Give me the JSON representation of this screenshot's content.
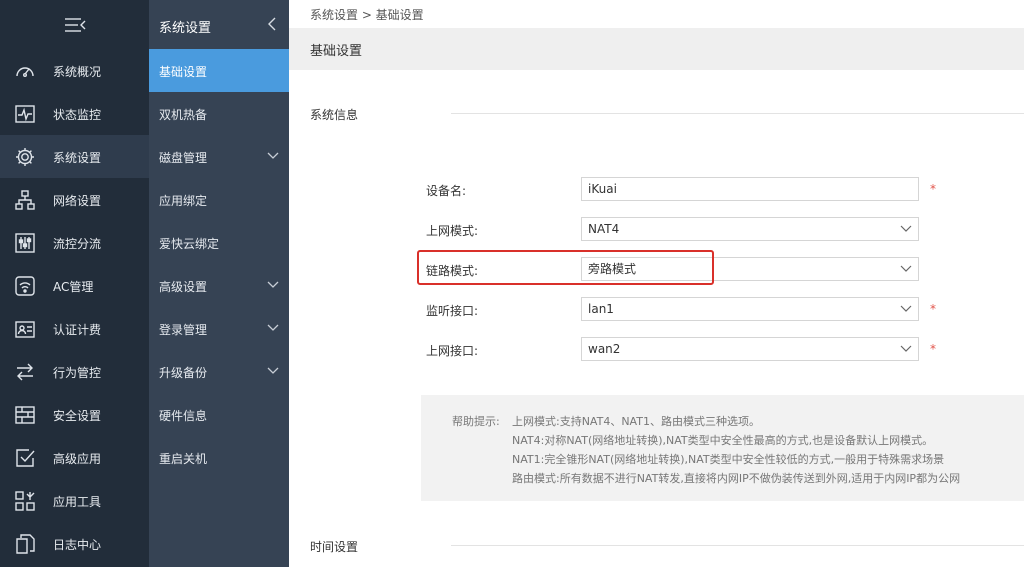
{
  "nav1": {
    "toggle_icon": "menu-collapse-icon",
    "items": [
      {
        "label": "系统概况",
        "icon": "gauge-icon"
      },
      {
        "label": "状态监控",
        "icon": "monitor-pulse-icon"
      },
      {
        "label": "系统设置",
        "icon": "gear-icon"
      },
      {
        "label": "网络设置",
        "icon": "network-icon"
      },
      {
        "label": "流控分流",
        "icon": "sliders-icon"
      },
      {
        "label": "AC管理",
        "icon": "wifi-router-icon"
      },
      {
        "label": "认证计费",
        "icon": "id-card-icon"
      },
      {
        "label": "行为管控",
        "icon": "swap-arrows-icon"
      },
      {
        "label": "安全设置",
        "icon": "firewall-icon"
      },
      {
        "label": "高级应用",
        "icon": "check-square-icon"
      },
      {
        "label": "应用工具",
        "icon": "tools-grid-icon"
      },
      {
        "label": "日志中心",
        "icon": "document-icon"
      }
    ]
  },
  "nav2": {
    "title": "系统设置",
    "items": [
      {
        "label": "基础设置"
      },
      {
        "label": "双机热备"
      },
      {
        "label": "磁盘管理"
      },
      {
        "label": "应用绑定"
      },
      {
        "label": "爱快云绑定"
      },
      {
        "label": "高级设置"
      },
      {
        "label": "登录管理"
      },
      {
        "label": "升级备份"
      },
      {
        "label": "硬件信息"
      },
      {
        "label": "重启关机"
      }
    ]
  },
  "main": {
    "breadcrumb": "系统设置 > 基础设置",
    "page_title": "基础设置",
    "section_system": "系统信息",
    "section_time": "时间设置",
    "form": {
      "device_name_label": "设备名:",
      "device_name_value": "iKuai",
      "net_mode_label": "上网模式:",
      "net_mode_value": "NAT4",
      "link_mode_label": "链路模式:",
      "link_mode_value": "旁路模式",
      "listen_if_label": "监听接口:",
      "listen_if_value": "lan1",
      "wan_if_label": "上网接口:",
      "wan_if_value": "wan2",
      "required_mark": "*"
    },
    "help": {
      "prefix": "帮助提示:",
      "line1": "上网模式:支持NAT4、NAT1、路由模式三种选项。",
      "line2": "NAT4:对称NAT(网络地址转换),NAT类型中安全性最高的方式,也是设备默认上网模式。",
      "line3": "NAT1:完全锥形NAT(网络地址转换),NAT类型中安全性较低的方式,一般用于特殊需求场景",
      "line4": "路由模式:所有数据不进行NAT转发,直接将内网IP不做伪装传送到外网,适用于内网IP都为公网"
    }
  },
  "colors": {
    "accent": "#4a9bde",
    "sidebar_dark": "#222d3a",
    "sidebar_mid": "#364354",
    "highlight": "#d9302a",
    "required": "#e2544b"
  }
}
